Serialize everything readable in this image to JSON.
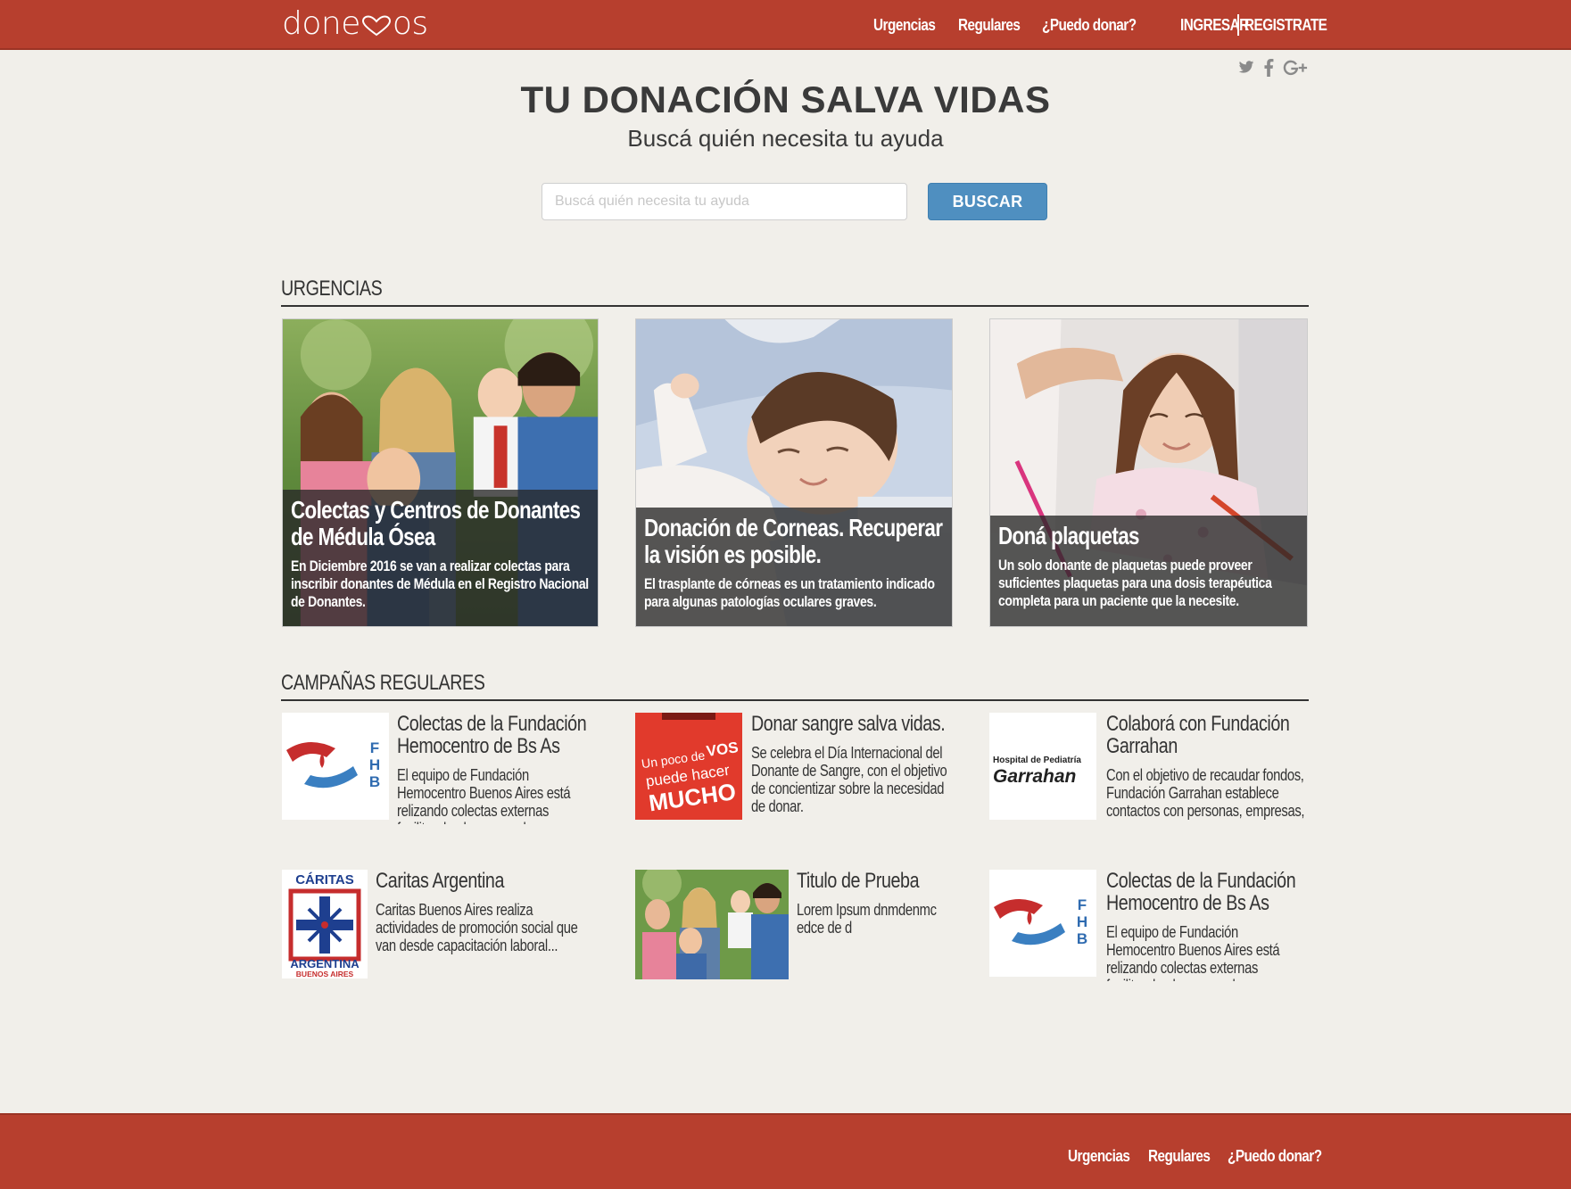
{
  "header": {
    "logo_left": "done",
    "logo_right": "os",
    "nav": [
      "Urgencias",
      "Regulares",
      "¿Puedo donar?"
    ],
    "login": "INGRESAR",
    "register": "REGISTRATE"
  },
  "social": [
    "twitter-icon",
    "facebook-icon",
    "google-plus-icon"
  ],
  "hero": {
    "title": "TU DONACIÓN SALVA VIDAS",
    "subtitle": "Buscá quién necesita tu ayuda"
  },
  "search": {
    "placeholder": "Buscá quién necesita tu ayuda",
    "button": "BUSCAR"
  },
  "urgencias": {
    "heading": "URGENCIAS",
    "cards": [
      {
        "title": "Colectas y Centros de Donantes de Médula Ósea",
        "desc": "En Diciembre 2016 se van a realizar colectas para inscribir donantes de Médula en el Registro Nacional de Donantes."
      },
      {
        "title": "Donación de Corneas. Recuperar la visión es posible.",
        "desc": "El trasplante de córneas es un tratamiento indicado para algunas patologías oculares graves."
      },
      {
        "title": "Doná plaquetas",
        "desc": "Un solo donante de plaquetas puede proveer suficientes plaquetas para una dosis terapéutica completa para un paciente que la necesite."
      }
    ]
  },
  "regulares": {
    "heading": "CAMPAÑAS REGULARES",
    "items": [
      {
        "title": "Colectas de la Fundación Hemocentro de Bs As",
        "desc": "El equipo de Fundación Hemocentro Buenos Aires está relizando colectas externas facilitando el acceso a los",
        "logo_text": [
          "F",
          "H",
          "B"
        ]
      },
      {
        "title": "Donar sangre salva vidas.",
        "desc": "Se celebra el Día Internacional del Donante de Sangre, con el objetivo de concientizar sobre la necesidad de donar.",
        "logo_text": [
          "Un poco de",
          "VOS",
          "puede hacer",
          "MUCHO"
        ]
      },
      {
        "title": "Colaborá con Fundación Garrahan",
        "desc": "Con el objetivo de recaudar fondos, Fundación Garrahan establece contactos con personas, empresas,",
        "logo_text": [
          "Hospital de Pediatría",
          "Garrahan"
        ]
      },
      {
        "title": "Caritas Argentina",
        "desc": "Caritas Buenos Aires realiza actividades de promoción social que van desde capacitación laboral...",
        "logo_text": [
          "CÁRITAS",
          "ARGENTINA",
          "BUENOS AIRES"
        ]
      },
      {
        "title": "Titulo de Prueba",
        "desc": "Lorem Ipsum dnmdenmc edce de d",
        "logo_text": []
      },
      {
        "title": "Colectas de la Fundación Hemocentro de Bs As",
        "desc": "El equipo de Fundación Hemocentro Buenos Aires está relizando colectas externas facilitando el acceso a los",
        "logo_text": [
          "F",
          "H",
          "B"
        ]
      }
    ]
  },
  "footer": {
    "nav": [
      "Urgencias",
      "Regulares",
      "¿Puedo donar?"
    ]
  },
  "colors": {
    "brand_red": "#b73f2e",
    "button_blue": "#4f8fc0",
    "background": "#f1efea"
  }
}
